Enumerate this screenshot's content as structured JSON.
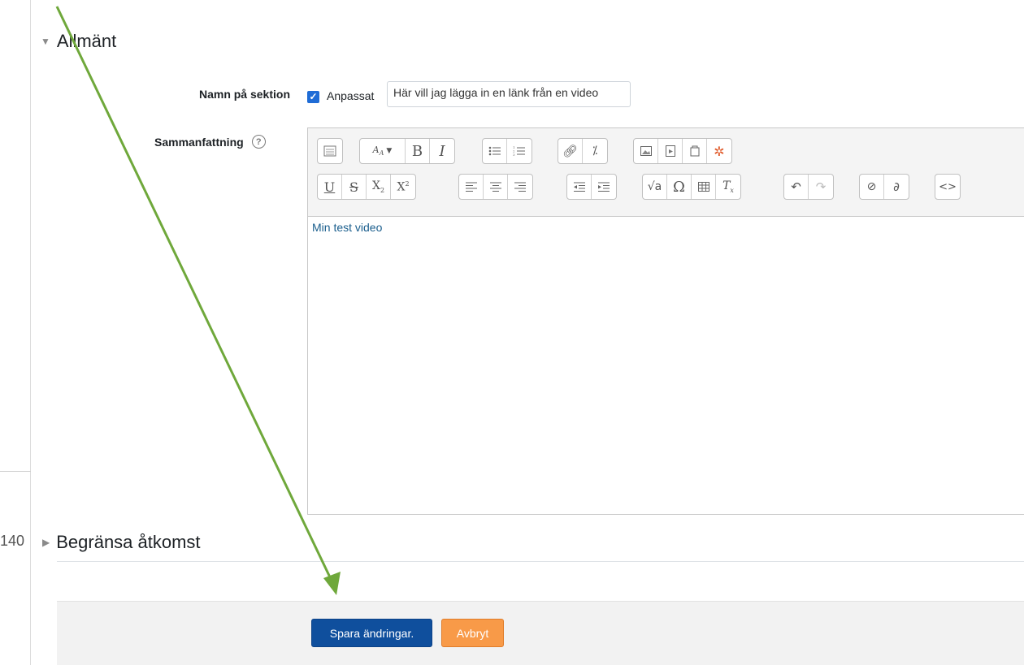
{
  "truncated_left_text": "140",
  "section_general": {
    "title": "Allmänt"
  },
  "section_name": {
    "label": "Namn på sektion",
    "checkbox_label": "Anpassat",
    "input_value": "Här vill jag lägga in en länk från en video"
  },
  "summary": {
    "label": "Sammanfattning",
    "help_icon": "?",
    "editor_content": "Min test video",
    "toolbar_icons": [
      "show-more-icon",
      "font-style-icon",
      "bold-icon",
      "italic-icon",
      "unordered-list-icon",
      "ordered-list-icon",
      "link-icon",
      "unlink-icon",
      "image-icon",
      "media-icon",
      "manage-files-icon",
      "h5p-icon",
      "underline-icon",
      "strikethrough-icon",
      "subscript-icon",
      "superscript-icon",
      "align-left-icon",
      "align-center-icon",
      "align-right-icon",
      "outdent-icon",
      "indent-icon",
      "equation-icon",
      "special-character-icon",
      "table-icon",
      "clear-formatting-icon",
      "undo-icon",
      "redo-icon",
      "accessibility-checker-icon",
      "screenreader-helper-icon",
      "html-icon"
    ]
  },
  "section_restrict": {
    "title": "Begränsa åtkomst"
  },
  "buttons": {
    "save": "Spara ändringar.",
    "cancel": "Avbryt"
  },
  "colors": {
    "primary": "#0f4f9d",
    "cancel": "#f89a48",
    "arrow": "#6fa83b",
    "checkbox": "#1f6cd6"
  }
}
